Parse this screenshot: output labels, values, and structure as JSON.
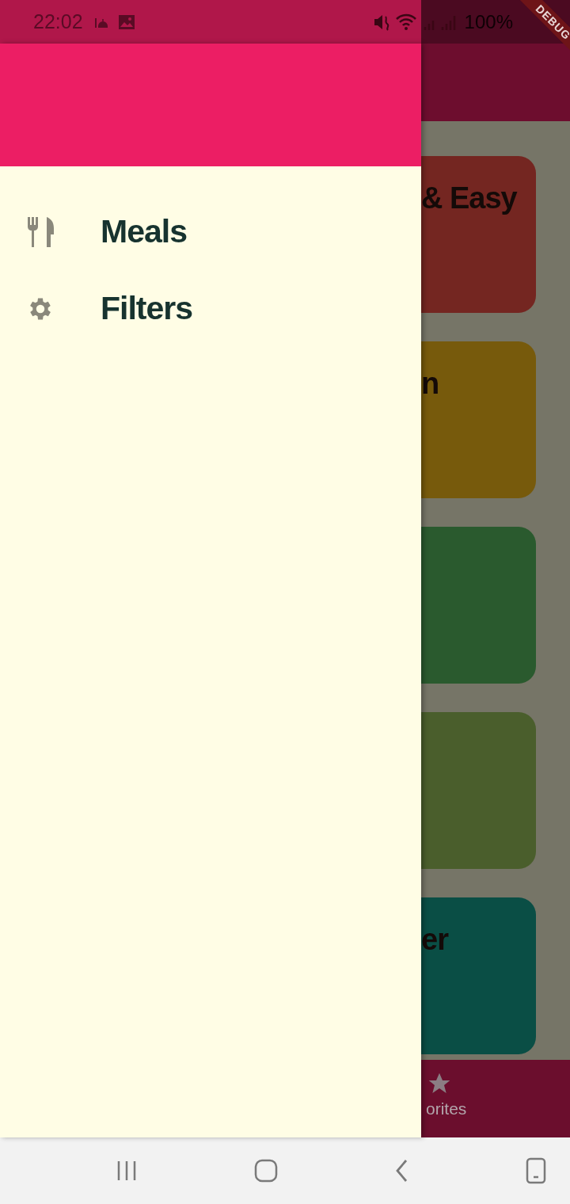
{
  "status_bar": {
    "time": "22:02",
    "battery": "100%"
  },
  "debug_banner": {
    "label": "DEBUG"
  },
  "drawer": {
    "items": [
      {
        "label": "Meals",
        "kind": "meals"
      },
      {
        "label": "Filters",
        "kind": "filters"
      }
    ]
  },
  "categories": [
    {
      "title": "& Easy",
      "color": "#742621"
    },
    {
      "title": "n",
      "color": "#775a0c"
    },
    {
      "color": "#2a5a2e"
    },
    {
      "color": "#4a5e2c"
    },
    {
      "title": "er",
      "color": "#0a4e45"
    }
  ],
  "bottom_nav": {
    "label": "orites"
  }
}
